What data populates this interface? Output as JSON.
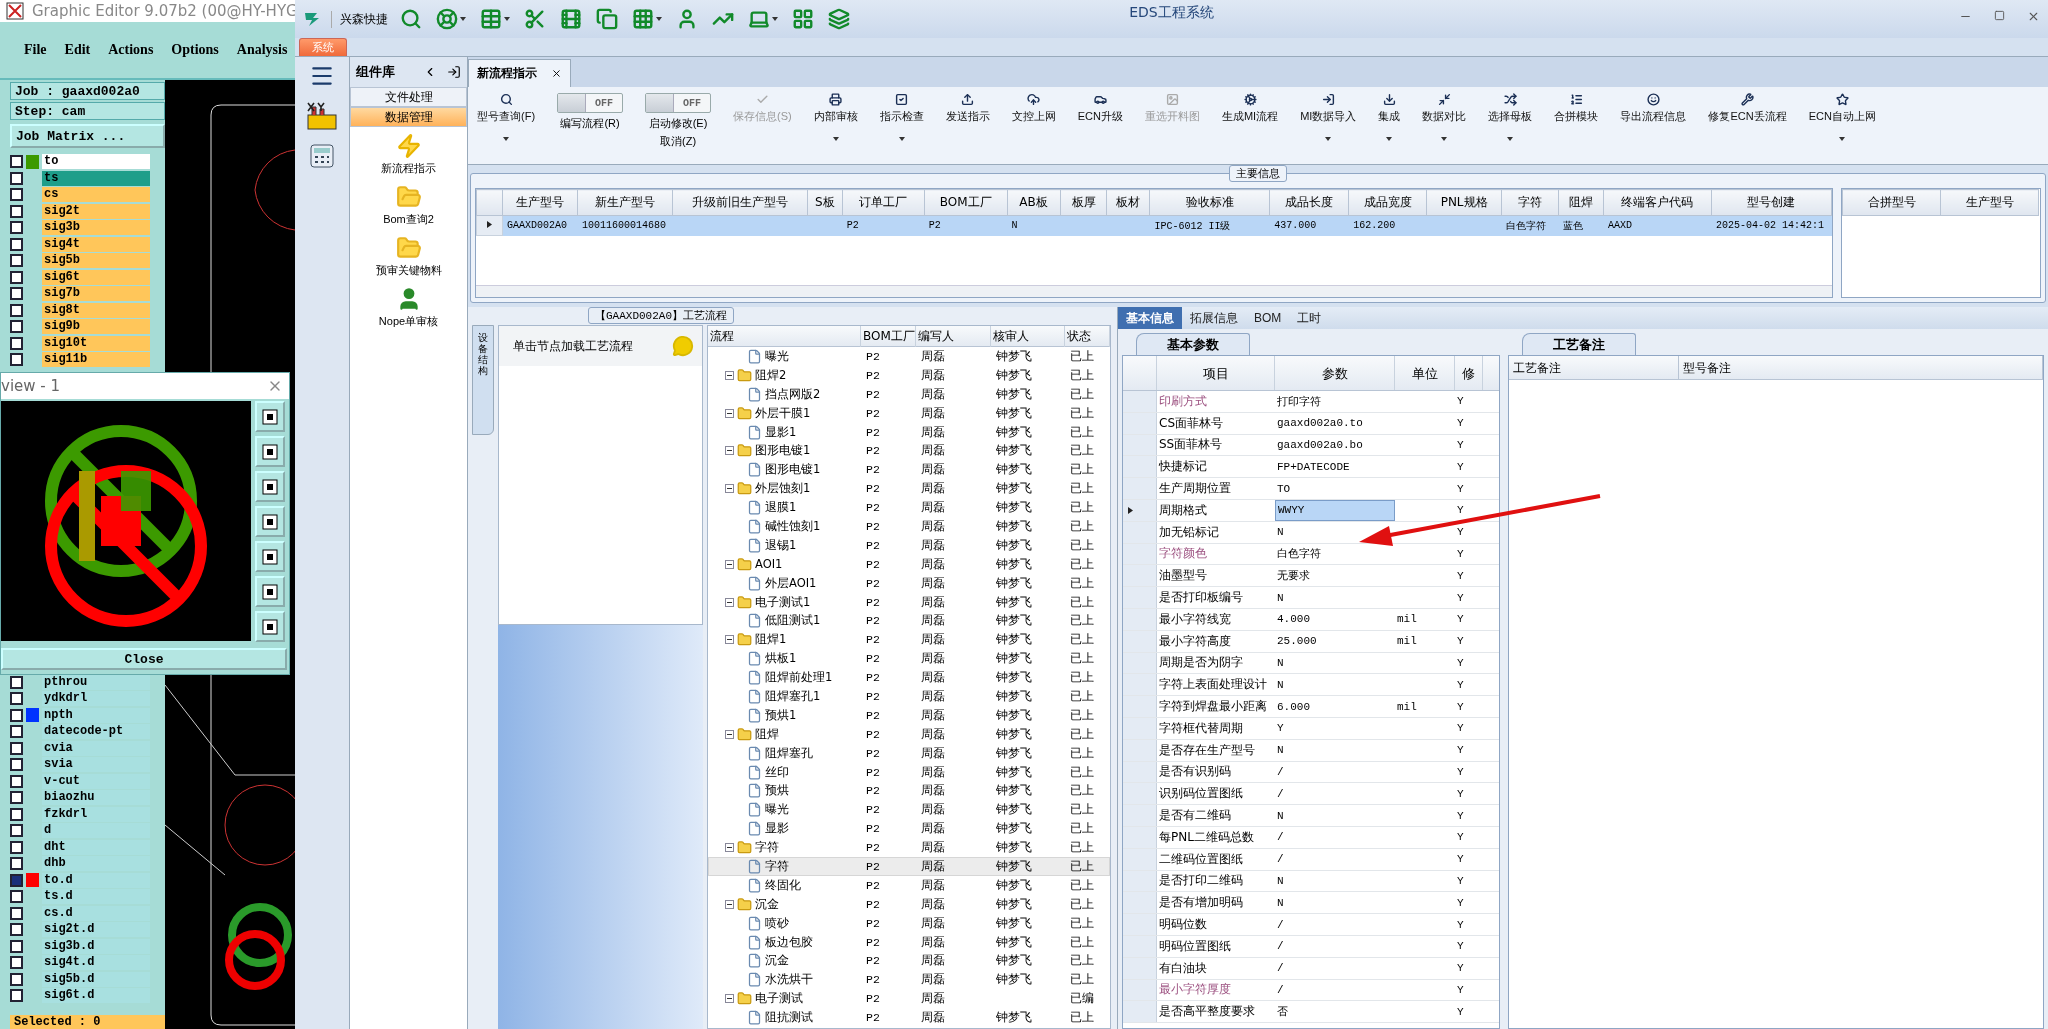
{
  "editor": {
    "title": "Graphic Editor 9.07b2 (00@HY-HYG",
    "menu": [
      "File",
      "Edit",
      "Actions",
      "Options",
      "Analysis"
    ],
    "job": "Job : gaaxd002a0",
    "step": "Step: cam",
    "matrix_button": "Job Matrix ...",
    "layers_top": [
      {
        "name": "to",
        "color": "#ffffff",
        "swatch": {
          "color": "#3c9a00"
        },
        "checked": false
      },
      {
        "name": "ts",
        "color": "#1e9e8a",
        "checked": false
      },
      {
        "name": "cs",
        "color": "#ffc65a",
        "checked": false
      },
      {
        "name": "sig2t",
        "color": "#ffc65a",
        "checked": false
      },
      {
        "name": "sig3b",
        "color": "#ffc65a",
        "checked": false
      },
      {
        "name": "sig4t",
        "color": "#ffc65a",
        "checked": false
      },
      {
        "name": "sig5b",
        "color": "#ffc65a",
        "checked": false
      },
      {
        "name": "sig6t",
        "color": "#ffc65a",
        "checked": false
      },
      {
        "name": "sig7b",
        "color": "#ffc65a",
        "checked": false
      },
      {
        "name": "sig8t",
        "color": "#ffc65a",
        "checked": false
      },
      {
        "name": "sig9b",
        "color": "#ffc65a",
        "checked": false
      },
      {
        "name": "sig10t",
        "color": "#ffc65a",
        "checked": false
      },
      {
        "name": "sig11b",
        "color": "#ffc65a",
        "checked": false
      }
    ],
    "layers_bottom": [
      {
        "name": "pthrou",
        "color": "#a8e0e0",
        "checked": false
      },
      {
        "name": "ydkdrl",
        "color": "#a8e0e0",
        "checked": false
      },
      {
        "name": "npth",
        "color": "#a8e0e0",
        "swatch": {
          "color": "#0033ff"
        },
        "checked": false
      },
      {
        "name": "datecode-pt",
        "color": "#a8e0e0",
        "checked": false
      },
      {
        "name": "cvia",
        "color": "#a8e0e0",
        "checked": false
      },
      {
        "name": "svia",
        "color": "#a8e0e0",
        "checked": false
      },
      {
        "name": "v-cut",
        "color": "#a8e0e0",
        "checked": false
      },
      {
        "name": "biaozhu",
        "color": "#a8e0e0",
        "checked": false
      },
      {
        "name": "fzkdrl",
        "color": "#a8e0e0",
        "checked": false
      },
      {
        "name": "d",
        "color": "#a8e0e0",
        "checked": false
      },
      {
        "name": "dht",
        "color": "#a8e0e0",
        "checked": false
      },
      {
        "name": "dhb",
        "color": "#a8e0e0",
        "checked": false
      },
      {
        "name": "to.d",
        "color": "#a8e0e0",
        "swatch": {
          "color": "#ff0000"
        },
        "checked": true
      },
      {
        "name": "ts.d",
        "color": "#a8e0e0",
        "checked": false
      },
      {
        "name": "cs.d",
        "color": "#a8e0e0",
        "checked": false
      },
      {
        "name": "sig2t.d",
        "color": "#a8e0e0",
        "checked": false
      },
      {
        "name": "sig3b.d",
        "color": "#a8e0e0",
        "checked": false
      },
      {
        "name": "sig4t.d",
        "color": "#a8e0e0",
        "checked": false
      },
      {
        "name": "sig5b.d",
        "color": "#a8e0e0",
        "checked": false
      },
      {
        "name": "sig6t.d",
        "color": "#a8e0e0",
        "checked": false
      }
    ],
    "status": "Selected : 0"
  },
  "preview": {
    "title": "view - 1",
    "close_button": "Close"
  },
  "app": {
    "quick_label": "兴森快捷",
    "title": "EDS工程系统",
    "ribbon_tabs": [
      {
        "label": "系统",
        "selected": true
      }
    ]
  },
  "component_library": {
    "title": "组件库",
    "groups": [
      {
        "label": "文件处理",
        "selected": false
      },
      {
        "label": "数据管理",
        "selected": true
      }
    ],
    "items": [
      {
        "label": "新流程指示",
        "kind": "flash"
      },
      {
        "label": "Bom查询2",
        "kind": "folder"
      },
      {
        "label": "预审关键物料",
        "kind": "folder"
      },
      {
        "label": "Nope单审核",
        "kind": "person"
      }
    ]
  },
  "doc_tabs": [
    {
      "label": "新流程指示",
      "selected": true
    }
  ],
  "ribbon": [
    {
      "kind": "button",
      "label": "型号查询(F)",
      "dropdown": true,
      "disabled": false
    },
    {
      "kind": "toggle",
      "label": "编写流程(R)",
      "state_label": "OFF",
      "on": false
    },
    {
      "kind": "toggle",
      "label": "启动修改(E)",
      "label2": "取消(Z)",
      "state_label": "OFF",
      "on": false
    },
    {
      "kind": "button",
      "label": "保存信息(S)",
      "dropdown": false,
      "disabled": true
    },
    {
      "kind": "button",
      "label": "内部审核",
      "dropdown": true,
      "disabled": false
    },
    {
      "kind": "button",
      "label": "指示检查",
      "dropdown": true,
      "disabled": false
    },
    {
      "kind": "button",
      "label": "发送指示",
      "dropdown": false,
      "disabled": false
    },
    {
      "kind": "button",
      "label": "文控上网",
      "dropdown": false,
      "disabled": false
    },
    {
      "kind": "button",
      "label": "ECN升级",
      "dropdown": false,
      "disabled": false
    },
    {
      "kind": "button",
      "label": "重选开料图",
      "dropdown": false,
      "disabled": true
    },
    {
      "kind": "button",
      "label": "生成MI流程",
      "dropdown": false,
      "disabled": false
    },
    {
      "kind": "button",
      "label": "MI数据导入",
      "dropdown": true,
      "disabled": false
    },
    {
      "kind": "button",
      "label": "集成",
      "dropdown": true,
      "disabled": false
    },
    {
      "kind": "button",
      "label": "数据对比",
      "dropdown": true,
      "disabled": false
    },
    {
      "kind": "button",
      "label": "选择母板",
      "dropdown": true,
      "disabled": false
    },
    {
      "kind": "button",
      "label": "合拼模块",
      "dropdown": false,
      "disabled": false
    },
    {
      "kind": "button",
      "label": "导出流程信息",
      "dropdown": false,
      "disabled": false
    },
    {
      "kind": "button",
      "label": "修复ECN丢流程",
      "dropdown": false,
      "disabled": false
    },
    {
      "kind": "button",
      "label": "ECN自动上网",
      "dropdown": true,
      "disabled": false
    }
  ],
  "main_info": {
    "title": "主要信息",
    "columns": [
      "生产型号",
      "新生产型号",
      "升级前旧生产型号",
      "S板",
      "订单工厂",
      "BOM工厂",
      "AB板",
      "板厚",
      "板材",
      "验收标准",
      "成品长度",
      "成品宽度",
      "PNL规格",
      "字符",
      "阻焊",
      "终端客户代码",
      "型号创建"
    ],
    "rows": [
      {
        "selected": true,
        "cells": [
          "GAAXD002A0",
          "10011600014680",
          null,
          null,
          "P2",
          "P2",
          "N",
          null,
          null,
          "IPC-6012 II级",
          "437.000",
          "162.200",
          null,
          "白色字符",
          "蓝色",
          "AAXD",
          "2025-04-02 14:42:1"
        ]
      }
    ],
    "side_columns": [
      "合拼型号",
      "生产型号"
    ]
  },
  "flow": {
    "title": "【GAAXD002A0】工艺流程",
    "side_tab": "设备结构",
    "hint": "单击节点加载工艺流程",
    "columns": [
      "流程",
      "BOM工厂",
      "编写人",
      "核审人",
      "状态"
    ],
    "tree": [
      {
        "label": "曝光",
        "kind": "file",
        "bom": "P2",
        "author": "周磊",
        "reviewer": "钟梦飞",
        "status": "已上",
        "selected": false
      },
      {
        "label": "阻焊2",
        "kind": "folder",
        "expanded": true,
        "bom": "P2",
        "author": "周磊",
        "reviewer": "钟梦飞",
        "status": "已上",
        "selected": false,
        "children": [
          {
            "label": "挡点网版2",
            "kind": "file",
            "bom": "P2",
            "author": "周磊",
            "reviewer": "钟梦飞",
            "status": "已上",
            "selected": false
          }
        ]
      },
      {
        "label": "外层干膜1",
        "kind": "folder",
        "expanded": true,
        "bom": "P2",
        "author": "周磊",
        "reviewer": "钟梦飞",
        "status": "已上",
        "selected": false,
        "children": [
          {
            "label": "显影1",
            "kind": "file",
            "bom": "P2",
            "author": "周磊",
            "reviewer": "钟梦飞",
            "status": "已上",
            "selected": false
          }
        ]
      },
      {
        "label": "图形电镀1",
        "kind": "folder",
        "expanded": true,
        "bom": "P2",
        "author": "周磊",
        "reviewer": "钟梦飞",
        "status": "已上",
        "selected": false,
        "children": [
          {
            "label": "图形电镀1",
            "kind": "file",
            "bom": "P2",
            "author": "周磊",
            "reviewer": "钟梦飞",
            "status": "已上",
            "selected": false
          }
        ]
      },
      {
        "label": "外层蚀刻1",
        "kind": "folder",
        "expanded": true,
        "bom": "P2",
        "author": "周磊",
        "reviewer": "钟梦飞",
        "status": "已上",
        "selected": false,
        "children": [
          {
            "label": "退膜1",
            "kind": "file",
            "bom": "P2",
            "author": "周磊",
            "reviewer": "钟梦飞",
            "status": "已上",
            "selected": false
          },
          {
            "label": "碱性蚀刻1",
            "kind": "file",
            "bom": "P2",
            "author": "周磊",
            "reviewer": "钟梦飞",
            "status": "已上",
            "selected": false
          },
          {
            "label": "退锡1",
            "kind": "file",
            "bom": "P2",
            "author": "周磊",
            "reviewer": "钟梦飞",
            "status": "已上",
            "selected": false
          }
        ]
      },
      {
        "label": "AOI1",
        "kind": "folder",
        "expanded": true,
        "bom": "P2",
        "author": "周磊",
        "reviewer": "钟梦飞",
        "status": "已上",
        "selected": false,
        "children": [
          {
            "label": "外层AOI1",
            "kind": "file",
            "bom": "P2",
            "author": "周磊",
            "reviewer": "钟梦飞",
            "status": "已上",
            "selected": false
          }
        ]
      },
      {
        "label": "电子测试1",
        "kind": "folder",
        "expanded": true,
        "bom": "P2",
        "author": "周磊",
        "reviewer": "钟梦飞",
        "status": "已上",
        "selected": false,
        "children": [
          {
            "label": "低阻测试1",
            "kind": "file",
            "bom": "P2",
            "author": "周磊",
            "reviewer": "钟梦飞",
            "status": "已上",
            "selected": false
          }
        ]
      },
      {
        "label": "阻焊1",
        "kind": "folder",
        "expanded": true,
        "bom": "P2",
        "author": "周磊",
        "reviewer": "钟梦飞",
        "status": "已上",
        "selected": false,
        "children": [
          {
            "label": "烘板1",
            "kind": "file",
            "bom": "P2",
            "author": "周磊",
            "reviewer": "钟梦飞",
            "status": "已上",
            "selected": false
          },
          {
            "label": "阻焊前处理1",
            "kind": "file",
            "bom": "P2",
            "author": "周磊",
            "reviewer": "钟梦飞",
            "status": "已上",
            "selected": false
          },
          {
            "label": "阻焊塞孔1",
            "kind": "file",
            "bom": "P2",
            "author": "周磊",
            "reviewer": "钟梦飞",
            "status": "已上",
            "selected": false
          },
          {
            "label": "预烘1",
            "kind": "file",
            "bom": "P2",
            "author": "周磊",
            "reviewer": "钟梦飞",
            "status": "已上",
            "selected": false
          }
        ]
      },
      {
        "label": "阻焊",
        "kind": "folder",
        "expanded": true,
        "bom": "P2",
        "author": "周磊",
        "reviewer": "钟梦飞",
        "status": "已上",
        "selected": false,
        "children": [
          {
            "label": "阻焊塞孔",
            "kind": "file",
            "bom": "P2",
            "author": "周磊",
            "reviewer": "钟梦飞",
            "status": "已上",
            "selected": false
          },
          {
            "label": "丝印",
            "kind": "file",
            "bom": "P2",
            "author": "周磊",
            "reviewer": "钟梦飞",
            "status": "已上",
            "selected": false
          },
          {
            "label": "预烘",
            "kind": "file",
            "bom": "P2",
            "author": "周磊",
            "reviewer": "钟梦飞",
            "status": "已上",
            "selected": false
          },
          {
            "label": "曝光",
            "kind": "file",
            "bom": "P2",
            "author": "周磊",
            "reviewer": "钟梦飞",
            "status": "已上",
            "selected": false
          },
          {
            "label": "显影",
            "kind": "file",
            "bom": "P2",
            "author": "周磊",
            "reviewer": "钟梦飞",
            "status": "已上",
            "selected": false
          }
        ]
      },
      {
        "label": "字符",
        "kind": "folder",
        "expanded": true,
        "bom": "P2",
        "author": "周磊",
        "reviewer": "钟梦飞",
        "status": "已上",
        "selected": false,
        "children": [
          {
            "label": "字符",
            "kind": "file",
            "bom": "P2",
            "author": "周磊",
            "reviewer": "钟梦飞",
            "status": "已上",
            "selected": true
          },
          {
            "label": "终固化",
            "kind": "file",
            "bom": "P2",
            "author": "周磊",
            "reviewer": "钟梦飞",
            "status": "已上",
            "selected": false
          }
        ]
      },
      {
        "label": "沉金",
        "kind": "folder",
        "expanded": true,
        "bom": "P2",
        "author": "周磊",
        "reviewer": "钟梦飞",
        "status": "已上",
        "selected": false,
        "children": [
          {
            "label": "喷砂",
            "kind": "file",
            "bom": "P2",
            "author": "周磊",
            "reviewer": "钟梦飞",
            "status": "已上",
            "selected": false
          },
          {
            "label": "板边包胶",
            "kind": "file",
            "bom": "P2",
            "author": "周磊",
            "reviewer": "钟梦飞",
            "status": "已上",
            "selected": false
          },
          {
            "label": "沉金",
            "kind": "file",
            "bom": "P2",
            "author": "周磊",
            "reviewer": "钟梦飞",
            "status": "已上",
            "selected": false
          },
          {
            "label": "水洗烘干",
            "kind": "file",
            "bom": "P2",
            "author": "周磊",
            "reviewer": "钟梦飞",
            "status": "已上",
            "selected": false
          }
        ]
      },
      {
        "label": "电子测试",
        "kind": "folder",
        "expanded": true,
        "bom": "P2",
        "author": "周磊",
        "status": "已编",
        "selected": false,
        "children": [
          {
            "label": "阻抗测试",
            "kind": "file",
            "bom": "P2",
            "author": "周磊",
            "reviewer": "钟梦飞",
            "status": "已上",
            "selected": false
          }
        ]
      }
    ]
  },
  "detail_tabs": [
    {
      "label": "基本信息",
      "selected": true
    },
    {
      "label": "拓展信息",
      "selected": false
    },
    {
      "label": "BOM",
      "selected": false
    },
    {
      "label": "工时",
      "selected": false
    }
  ],
  "params": {
    "title": "基本参数",
    "columns": [
      "项目",
      "参数",
      "单位",
      "修"
    ],
    "rows": [
      {
        "item": "印刷方式",
        "value": "打印字符",
        "flag": "Y",
        "highlighted": true,
        "selected": false
      },
      {
        "item": "CS面菲林号",
        "value": "gaaxd002a0.to",
        "flag": "Y",
        "highlighted": false,
        "selected": false
      },
      {
        "item": "SS面菲林号",
        "value": "gaaxd002a0.bo",
        "flag": "Y",
        "highlighted": false,
        "selected": false
      },
      {
        "item": "快捷标记",
        "value": "FP+DATECODE",
        "flag": "Y",
        "highlighted": false,
        "selected": false
      },
      {
        "item": "生产周期位置",
        "value": "TO",
        "flag": "Y",
        "highlighted": false,
        "selected": false
      },
      {
        "item": "周期格式",
        "value": "WWYY",
        "flag": "Y",
        "highlighted": false,
        "selected": true
      },
      {
        "item": "加无铅标记",
        "value": "N",
        "flag": "Y",
        "highlighted": false,
        "selected": false
      },
      {
        "item": "字符颜色",
        "value": "白色字符",
        "flag": "Y",
        "highlighted": true,
        "selected": false
      },
      {
        "item": "油墨型号",
        "value": "无要求",
        "flag": "Y",
        "highlighted": false,
        "selected": false
      },
      {
        "item": "是否打印板编号",
        "value": "N",
        "flag": "Y",
        "highlighted": false,
        "selected": false
      },
      {
        "item": "最小字符线宽",
        "value": "4.000",
        "unit": "mil",
        "flag": "Y",
        "highlighted": false,
        "selected": false
      },
      {
        "item": "最小字符高度",
        "value": "25.000",
        "unit": "mil",
        "flag": "Y",
        "highlighted": false,
        "selected": false
      },
      {
        "item": "周期是否为阴字",
        "value": "N",
        "flag": "Y",
        "highlighted": false,
        "selected": false
      },
      {
        "item": "字符上表面处理设计",
        "value": "N",
        "flag": "Y",
        "highlighted": false,
        "selected": false
      },
      {
        "item": "字符到焊盘最小距离",
        "value": "6.000",
        "unit": "mil",
        "flag": "Y",
        "highlighted": false,
        "selected": false
      },
      {
        "item": "字符框代替周期",
        "value": "Y",
        "flag": "Y",
        "highlighted": false,
        "selected": false
      },
      {
        "item": "是否存在生产型号",
        "value": "N",
        "flag": "Y",
        "highlighted": false,
        "selected": false
      },
      {
        "item": "是否有识别码",
        "value": "/",
        "flag": "Y",
        "highlighted": false,
        "selected": false
      },
      {
        "item": "识别码位置图纸",
        "value": "/",
        "flag": "Y",
        "highlighted": false,
        "selected": false
      },
      {
        "item": "是否有二维码",
        "value": "N",
        "flag": "Y",
        "highlighted": false,
        "selected": false
      },
      {
        "item": "每PNL二维码总数",
        "value": "/",
        "flag": "Y",
        "highlighted": false,
        "selected": false
      },
      {
        "item": "二维码位置图纸",
        "value": "/",
        "flag": "Y",
        "highlighted": false,
        "selected": false
      },
      {
        "item": "是否打印二维码",
        "value": "N",
        "flag": "Y",
        "highlighted": false,
        "selected": false
      },
      {
        "item": "是否有增加明码",
        "value": "N",
        "flag": "Y",
        "highlighted": false,
        "selected": false
      },
      {
        "item": "明码位数",
        "value": "/",
        "flag": "Y",
        "highlighted": false,
        "selected": false
      },
      {
        "item": "明码位置图纸",
        "value": "/",
        "flag": "Y",
        "highlighted": false,
        "selected": false
      },
      {
        "item": "有白油块",
        "value": "/",
        "flag": "Y",
        "highlighted": false,
        "selected": false
      },
      {
        "item": "最小字符厚度",
        "value": "/",
        "flag": "Y",
        "highlighted": true,
        "selected": false
      },
      {
        "item": "是否高平整度要求",
        "value": "否",
        "flag": "Y",
        "highlighted": false,
        "selected": false
      }
    ]
  },
  "notes": {
    "title": "工艺备注",
    "columns": [
      "工艺备注",
      "型号备注"
    ]
  }
}
